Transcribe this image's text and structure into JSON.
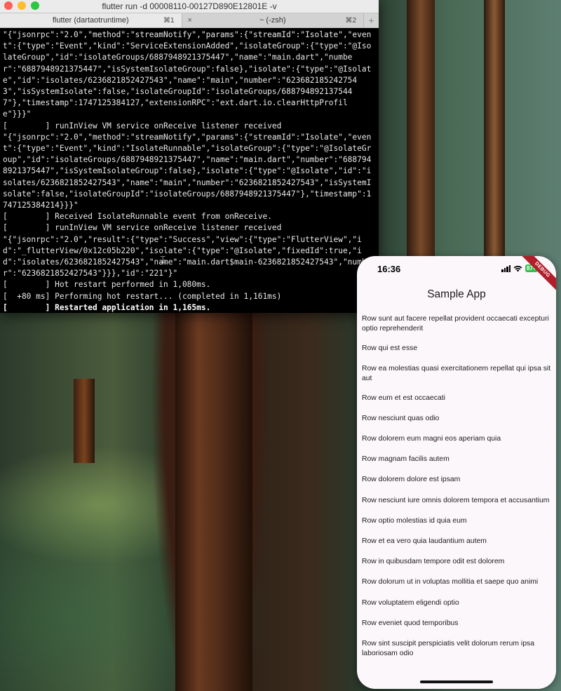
{
  "terminal": {
    "window_title": "flutter run -d 00008110-00127D890E12801E -v",
    "tabs": [
      {
        "label": "flutter (dartaotruntime)",
        "shortcut": "⌘1"
      },
      {
        "label": "~ (-zsh)",
        "shortcut": "⌘2",
        "close": "×"
      }
    ],
    "add_tab": "+",
    "lines": [
      "\"{\"jsonrpc\":\"2.0\",\"method\":\"streamNotify\",\"params\":{\"streamId\":\"Isolate\",\"event\":{\"type\":\"Event\",\"kind\":\"ServiceExtensionAdded\",\"isolateGroup\":{\"type\":\"@IsolateGroup\",\"id\":\"isolateGroups/6887948921375447\",\"name\":\"main.dart\",\"number\":\"6887948921375447\",\"isSystemIsolateGroup\":false},\"isolate\":{\"type\":\"@Isolate\",\"id\":\"isolates/6236821852427543\",\"name\":\"main\",\"number\":\"6236821852427543\",\"isSystemIsolate\":false,\"isolateGroupId\":\"isolateGroups/6887948921375447\"},\"timestamp\":1747125384127,\"extensionRPC\":\"ext.dart.io.clearHttpProfile\"}}}\"",
      "[        ] runInView VM service onReceive listener received",
      "\"{\"jsonrpc\":\"2.0\",\"method\":\"streamNotify\",\"params\":{\"streamId\":\"Isolate\",\"event\":{\"type\":\"Event\",\"kind\":\"IsolateRunnable\",\"isolateGroup\":{\"type\":\"@IsolateGroup\",\"id\":\"isolateGroups/6887948921375447\",\"name\":\"main.dart\",\"number\":\"6887948921375447\",\"isSystemIsolateGroup\":false},\"isolate\":{\"type\":\"@Isolate\",\"id\":\"isolates/6236821852427543\",\"name\":\"main\",\"number\":\"6236821852427543\",\"isSystemIsolate\":false,\"isolateGroupId\":\"isolateGroups/6887948921375447\"},\"timestamp\":1747125384214}}}\"",
      "[        ] Received IsolateRunnable event from onReceive.",
      "[        ] runInView VM service onReceive listener received",
      "\"{\"jsonrpc\":\"2.0\",\"result\":{\"type\":\"Success\",\"view\":{\"type\":\"FlutterView\",\"id\":\"_flutterView/0x12c05b220\",\"isolate\":{\"type\":\"@Isolate\",\"fixedId\":true,\"id\":\"isolates/6236821852427543\",\"name\":\"main.dart$main-6236821852427543\",\"number\":\"6236821852427543\"}}},\"id\":\"221\"}\"",
      "[        ] Hot restart performed in 1,080ms.",
      "[  +80 ms] Performing hot restart... (completed in 1,161ms)"
    ],
    "final_line": "[        ] Restarted application in 1,165ms."
  },
  "phone": {
    "time": "16:36",
    "battery": "87+",
    "debug_banner": "DEBUG",
    "app_title": "Sample App",
    "rows": [
      "Row sunt aut facere repellat provident occaecati excepturi optio reprehenderit",
      "Row qui est esse",
      "Row ea molestias quasi exercitationem repellat qui ipsa sit aut",
      "Row eum et est occaecati",
      "Row nesciunt quas odio",
      "Row dolorem eum magni eos aperiam quia",
      "Row magnam facilis autem",
      "Row dolorem dolore est ipsam",
      "Row nesciunt iure omnis dolorem tempora et accusantium",
      "Row optio molestias id quia eum",
      "Row et ea vero quia laudantium autem",
      "Row in quibusdam tempore odit est dolorem",
      "Row dolorum ut in voluptas mollitia et saepe quo animi",
      "Row voluptatem eligendi optio",
      "Row eveniet quod temporibus",
      "Row sint suscipit perspiciatis velit dolorum rerum ipsa laboriosam odio"
    ]
  }
}
